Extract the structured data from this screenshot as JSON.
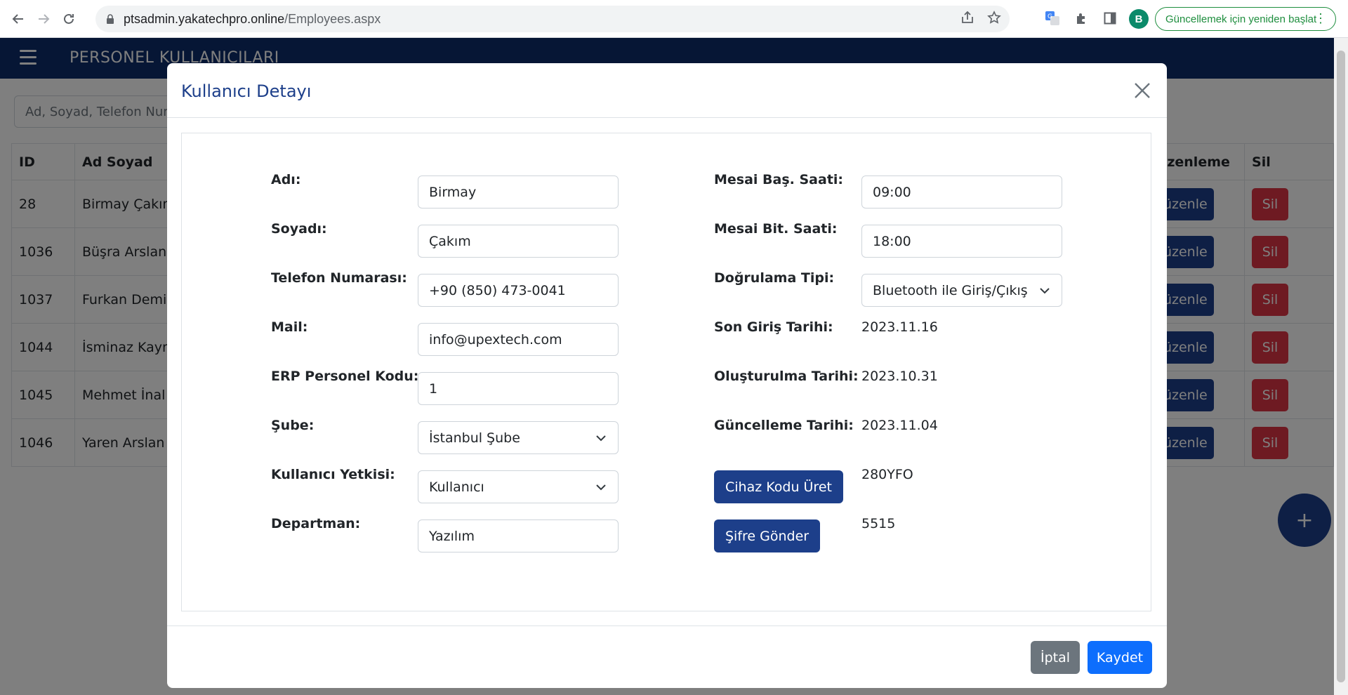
{
  "browser": {
    "url_host": "ptsadmin.yakatechpro.online",
    "url_path": "/Employees.aspx",
    "profile_initial": "B",
    "update_label": "Güncellemek için yeniden başlat"
  },
  "app": {
    "title": "PERSONEL KULLANICILARI",
    "search_placeholder": "Ad, Soyad, Telefon Numarası",
    "table": {
      "headers": {
        "id": "ID",
        "name": "Ad Soyad",
        "edit": "Düzenleme",
        "delete": "Sil"
      },
      "rows": [
        {
          "id": "28",
          "name": "Birmay Çakım"
        },
        {
          "id": "1036",
          "name": "Büşra Arslan"
        },
        {
          "id": "1037",
          "name": "Furkan Demir"
        },
        {
          "id": "1044",
          "name": "İsminaz Kaymak"
        },
        {
          "id": "1045",
          "name": "Mehmet İnal"
        },
        {
          "id": "1046",
          "name": "Yaren Arslan"
        }
      ],
      "edit_label": "Düzenle",
      "delete_label": "Sil"
    },
    "fab_label": "+"
  },
  "modal": {
    "title": "Kullanıcı Detayı",
    "left": {
      "first_name": {
        "label": "Adı:",
        "value": "Birmay"
      },
      "last_name": {
        "label": "Soyadı:",
        "value": "Çakım"
      },
      "phone": {
        "label": "Telefon Numarası:",
        "value": "+90 (850) 473-0041"
      },
      "mail": {
        "label": "Mail:",
        "value": "info@upextech.com"
      },
      "erp_code": {
        "label": "ERP Personel Kodu:",
        "value": "1"
      },
      "branch": {
        "label": "Şube:",
        "value": "İstanbul Şube"
      },
      "role": {
        "label": "Kullanıcı Yetkisi:",
        "value": "Kullanıcı"
      },
      "department": {
        "label": "Departman:",
        "value": "Yazılım"
      }
    },
    "right": {
      "shift_start": {
        "label": "Mesai Baş. Saati:",
        "value": "09:00"
      },
      "shift_end": {
        "label": "Mesai Bit. Saati:",
        "value": "18:00"
      },
      "auth_type": {
        "label": "Doğrulama Tipi:",
        "value": "Bluetooth ile Giriş/Çıkış"
      },
      "last_login": {
        "label": "Son Giriş Tarihi:",
        "value": "2023.11.16"
      },
      "created": {
        "label": "Oluşturulma Tarihi:",
        "value": "2023.10.31"
      },
      "updated": {
        "label": "Güncelleme Tarihi:",
        "value": "2023.11.04"
      },
      "device_code": {
        "button": "Cihaz Kodu Üret",
        "value": "280YFO"
      },
      "password": {
        "button": "Şifre Gönder",
        "value": "5515"
      }
    },
    "footer": {
      "cancel": "İptal",
      "save": "Kaydet"
    }
  },
  "colors": {
    "navbar": "#0d2d6b",
    "primary_dark": "#1d3f8a",
    "danger": "#dc3545",
    "save_blue": "#0d6efd",
    "cancel_gray": "#6c757d"
  }
}
